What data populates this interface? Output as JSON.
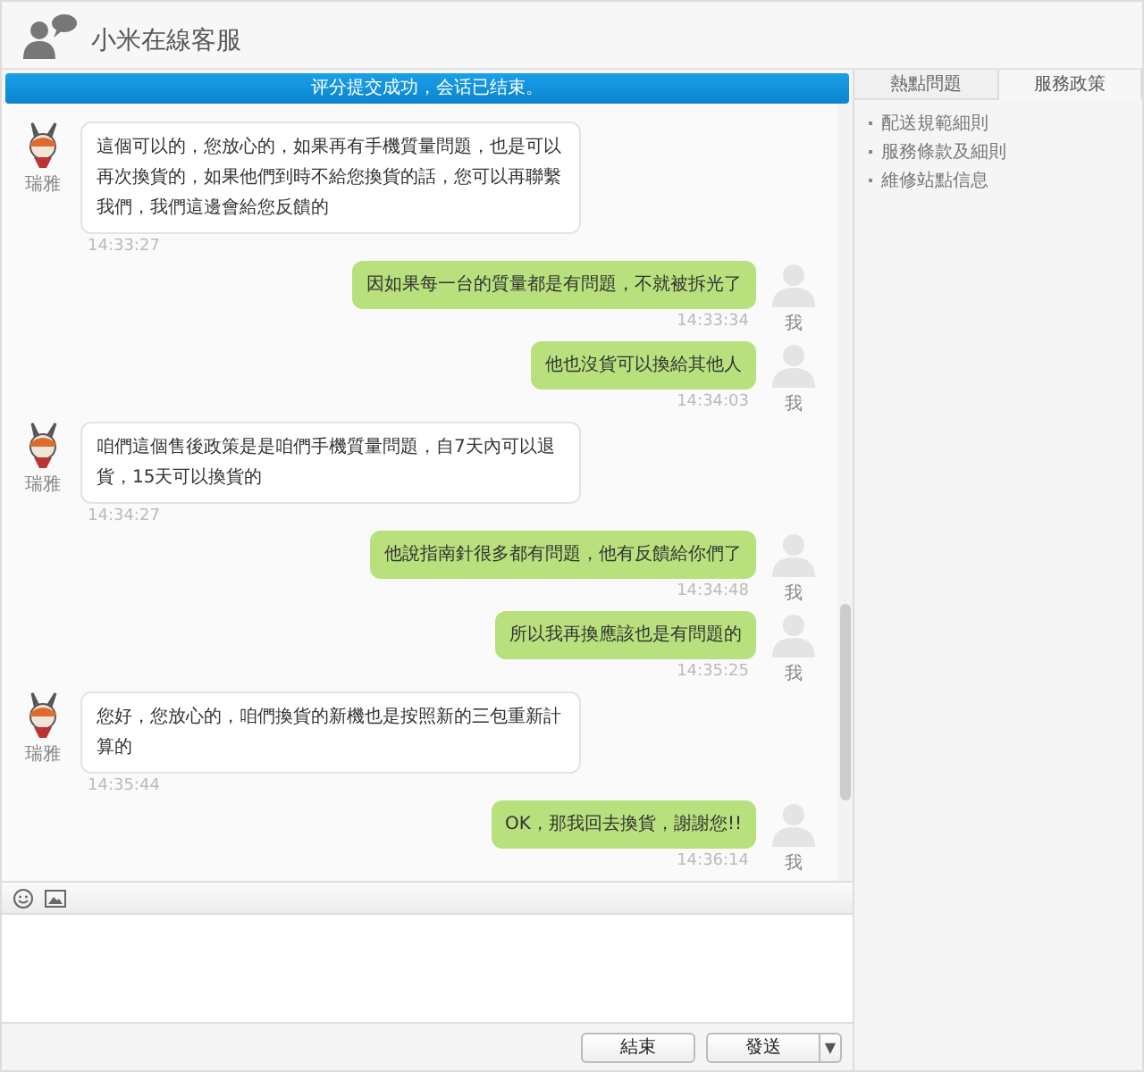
{
  "header": {
    "title": "小米在線客服"
  },
  "banner": "评分提交成功，会话已结束。",
  "messages": [
    {
      "kind": "agent",
      "sender": "瑞雅",
      "text": "這個可以的，您放心的，如果再有手機質量問題，也是可以再次換貨的，如果他們到時不給您換貨的話，您可以再聯繫我們，我們這邊會給您反饋的",
      "time": "14:33:27"
    },
    {
      "kind": "me",
      "sender": "我",
      "text": "因如果每一台的質量都是有問題，不就被拆光了",
      "time": "14:33:34"
    },
    {
      "kind": "me",
      "sender": "我",
      "text": "他也沒貨可以換給其他人",
      "time": "14:34:03"
    },
    {
      "kind": "agent",
      "sender": "瑞雅",
      "text": "咱們這個售後政策是是咱們手機質量問題，自7天內可以退貨，15天可以換貨的",
      "time": "14:34:27"
    },
    {
      "kind": "me",
      "sender": "我",
      "text": "他說指南針很多都有問題，他有反饋給你們了",
      "time": "14:34:48"
    },
    {
      "kind": "me",
      "sender": "我",
      "text": "所以我再換應該也是有問題的",
      "time": "14:35:25"
    },
    {
      "kind": "agent",
      "sender": "瑞雅",
      "text": "您好，您放心的，咱們換貨的新機也是按照新的三包重新計算的",
      "time": "14:35:44"
    },
    {
      "kind": "me",
      "sender": "我",
      "text": "OK，那我回去換貨，謝謝您!!",
      "time": "14:36:14"
    }
  ],
  "buttons": {
    "end": "結束",
    "send": "發送",
    "send_menu": "▼"
  },
  "side_panel": {
    "tabs": [
      {
        "label": "熱點問題",
        "selected": false
      },
      {
        "label": "服務政策",
        "selected": true
      }
    ],
    "links": [
      "配送規範細則",
      "服務條款及細則",
      "維修站點信息"
    ]
  }
}
